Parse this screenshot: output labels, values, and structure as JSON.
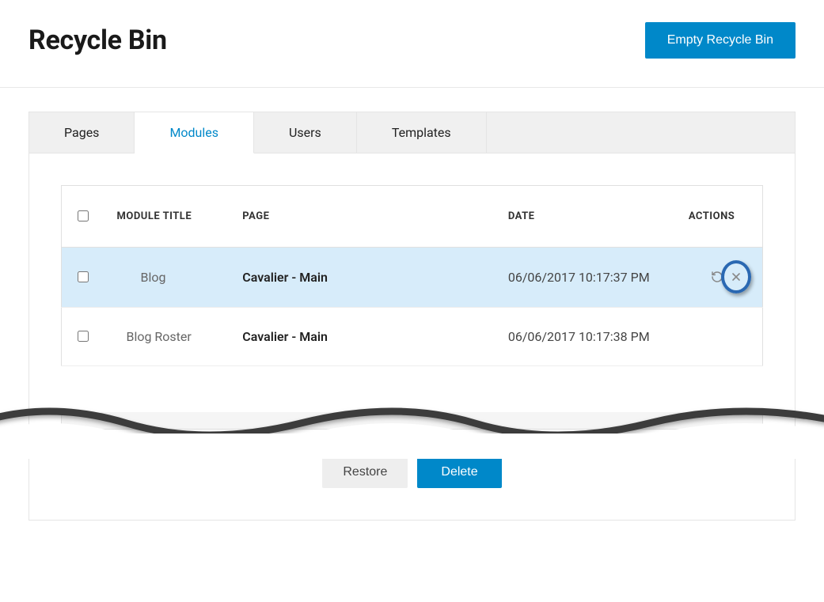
{
  "header": {
    "title": "Recycle Bin",
    "empty_button": "Empty Recycle Bin"
  },
  "tabs": [
    {
      "label": "Pages",
      "active": false
    },
    {
      "label": "Modules",
      "active": true
    },
    {
      "label": "Users",
      "active": false
    },
    {
      "label": "Templates",
      "active": false
    }
  ],
  "table": {
    "headers": {
      "module_title": "MODULE TITLE",
      "page": "PAGE",
      "date": "DATE",
      "actions": "ACTIONS"
    },
    "rows": [
      {
        "module_title": "Blog",
        "page": "Cavalier - Main",
        "date": "06/06/2017 10:17:37 PM",
        "highlighted": true,
        "show_actions": true
      },
      {
        "module_title": "Blog Roster",
        "page": "Cavalier - Main",
        "date": "06/06/2017 10:17:38 PM",
        "highlighted": false,
        "show_actions": false
      }
    ]
  },
  "footer": {
    "restore": "Restore",
    "delete": "Delete"
  }
}
